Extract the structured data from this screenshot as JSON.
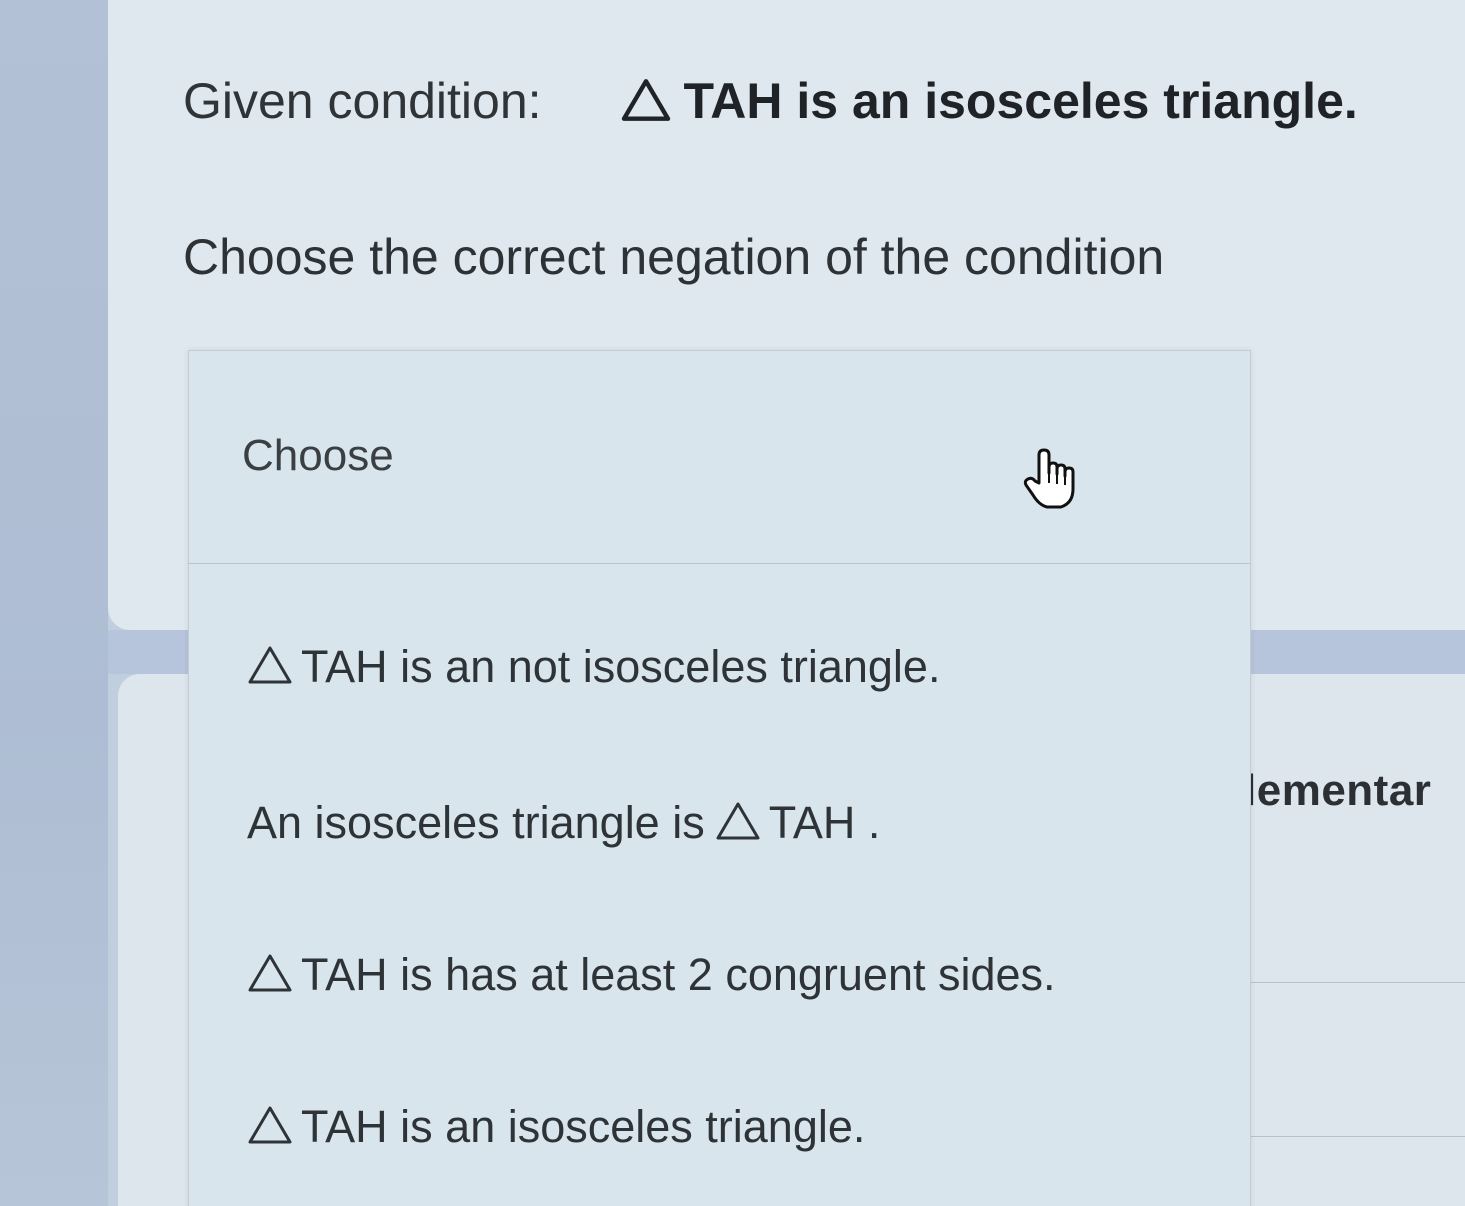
{
  "given": {
    "label": "Given condition:",
    "statement": "TAH is an isosceles triangle."
  },
  "instruction": "Choose the correct negation of the condition",
  "dropdown": {
    "selected": "Choose",
    "options": [
      {
        "prefix": "",
        "text": "TAH is an not isosceles triangle.",
        "triangle": "leading"
      },
      {
        "prefix": "An isosceles triangle is",
        "text": "TAH .",
        "triangle": "inline"
      },
      {
        "prefix": "",
        "text": "TAH is has at least 2 congruent sides.",
        "triangle": "leading"
      },
      {
        "prefix": "",
        "text": "TAH is an isosceles triangle.",
        "triangle": "leading"
      }
    ]
  },
  "next_card": {
    "partial_text": "lementar"
  },
  "icons": {
    "triangle": "triangle-icon",
    "cursor": "hand-pointer-icon"
  }
}
